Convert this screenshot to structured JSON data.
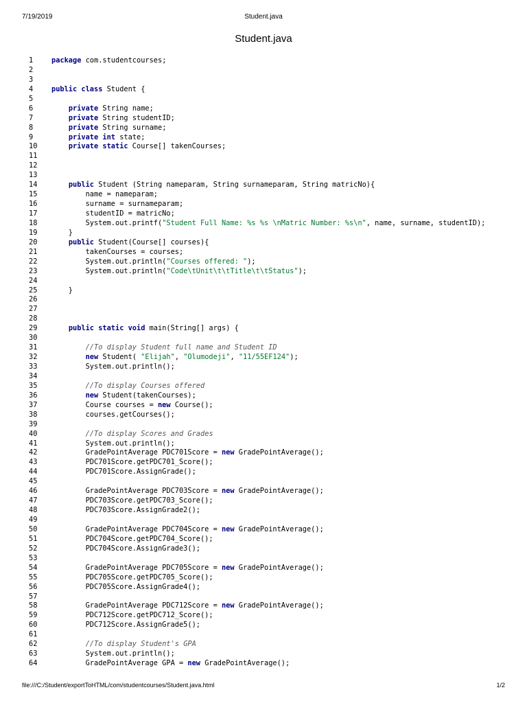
{
  "header": {
    "date": "7/19/2019",
    "file_title": "Student.java"
  },
  "document_title": "Student.java",
  "code_lines": [
    [
      [
        "kw",
        "package"
      ],
      [
        "p",
        " com.studentcourses;"
      ]
    ],
    [],
    [],
    [
      [
        "kw",
        "public class"
      ],
      [
        "p",
        " Student {"
      ]
    ],
    [],
    [
      [
        "p",
        "    "
      ],
      [
        "kw",
        "private"
      ],
      [
        "p",
        " String name;"
      ]
    ],
    [
      [
        "p",
        "    "
      ],
      [
        "kw",
        "private"
      ],
      [
        "p",
        " String studentID;"
      ]
    ],
    [
      [
        "p",
        "    "
      ],
      [
        "kw",
        "private"
      ],
      [
        "p",
        " String surname;"
      ]
    ],
    [
      [
        "p",
        "    "
      ],
      [
        "kw",
        "private int"
      ],
      [
        "p",
        " state;"
      ]
    ],
    [
      [
        "p",
        "    "
      ],
      [
        "kw",
        "private static"
      ],
      [
        "p",
        " Course[] takenCourses;"
      ]
    ],
    [],
    [],
    [],
    [
      [
        "p",
        "    "
      ],
      [
        "kw",
        "public"
      ],
      [
        "p",
        " Student (String nameparam, String surnameparam, String matricNo){"
      ]
    ],
    [
      [
        "p",
        "        name = nameparam;"
      ]
    ],
    [
      [
        "p",
        "        surname = surnameparam;"
      ]
    ],
    [
      [
        "p",
        "        studentID = matricNo;"
      ]
    ],
    [
      [
        "p",
        "        System.out.printf("
      ],
      [
        "str",
        "\"Student Full Name: %s %s \\nMatric Number: %s\\n\""
      ],
      [
        "p",
        ", name, surname, studentID);"
      ]
    ],
    [
      [
        "p",
        "    }"
      ]
    ],
    [
      [
        "p",
        "    "
      ],
      [
        "kw",
        "public"
      ],
      [
        "p",
        " Student(Course[] courses){"
      ]
    ],
    [
      [
        "p",
        "        takenCourses = courses;"
      ]
    ],
    [
      [
        "p",
        "        System.out.println("
      ],
      [
        "str",
        "\"Courses offered: \""
      ],
      [
        "p",
        ");"
      ]
    ],
    [
      [
        "p",
        "        System.out.println("
      ],
      [
        "str",
        "\"Code\\tUnit\\t\\tTitle\\t\\tStatus\""
      ],
      [
        "p",
        ");"
      ]
    ],
    [],
    [
      [
        "p",
        "    }"
      ]
    ],
    [],
    [],
    [],
    [
      [
        "p",
        "    "
      ],
      [
        "kw",
        "public static void"
      ],
      [
        "p",
        " main(String[] args) {"
      ]
    ],
    [],
    [
      [
        "p",
        "        "
      ],
      [
        "cmt",
        "//To display Student full name and Student ID"
      ]
    ],
    [
      [
        "p",
        "        "
      ],
      [
        "kw",
        "new"
      ],
      [
        "p",
        " Student( "
      ],
      [
        "str",
        "\"Elijah\""
      ],
      [
        "p",
        ", "
      ],
      [
        "str",
        "\"Olumodeji\""
      ],
      [
        "p",
        ", "
      ],
      [
        "str",
        "\"11/55EF124\""
      ],
      [
        "p",
        ");"
      ]
    ],
    [
      [
        "p",
        "        System.out.println();"
      ]
    ],
    [],
    [
      [
        "p",
        "        "
      ],
      [
        "cmt",
        "//To display Courses offered"
      ]
    ],
    [
      [
        "p",
        "        "
      ],
      [
        "kw",
        "new"
      ],
      [
        "p",
        " Student(takenCourses);"
      ]
    ],
    [
      [
        "p",
        "        Course courses = "
      ],
      [
        "kw",
        "new"
      ],
      [
        "p",
        " Course();"
      ]
    ],
    [
      [
        "p",
        "        courses.getCourses();"
      ]
    ],
    [],
    [
      [
        "p",
        "        "
      ],
      [
        "cmt",
        "//To display Scores and Grades"
      ]
    ],
    [
      [
        "p",
        "        System.out.println();"
      ]
    ],
    [
      [
        "p",
        "        GradePointAverage PDC701Score = "
      ],
      [
        "kw",
        "new"
      ],
      [
        "p",
        " GradePointAverage();"
      ]
    ],
    [
      [
        "p",
        "        PDC701Score.getPDC701_Score();"
      ]
    ],
    [
      [
        "p",
        "        PDC701Score.AssignGrade();"
      ]
    ],
    [],
    [
      [
        "p",
        "        GradePointAverage PDC703Score = "
      ],
      [
        "kw",
        "new"
      ],
      [
        "p",
        " GradePointAverage();"
      ]
    ],
    [
      [
        "p",
        "        PDC703Score.getPDC703_Score();"
      ]
    ],
    [
      [
        "p",
        "        PDC703Score.AssignGrade2();"
      ]
    ],
    [],
    [
      [
        "p",
        "        GradePointAverage PDC704Score = "
      ],
      [
        "kw",
        "new"
      ],
      [
        "p",
        " GradePointAverage();"
      ]
    ],
    [
      [
        "p",
        "        PDC704Score.getPDC704_Score();"
      ]
    ],
    [
      [
        "p",
        "        PDC704Score.AssignGrade3();"
      ]
    ],
    [],
    [
      [
        "p",
        "        GradePointAverage PDC705Score = "
      ],
      [
        "kw",
        "new"
      ],
      [
        "p",
        " GradePointAverage();"
      ]
    ],
    [
      [
        "p",
        "        PDC705Score.getPDC705_Score();"
      ]
    ],
    [
      [
        "p",
        "        PDC705Score.AssignGrade4();"
      ]
    ],
    [],
    [
      [
        "p",
        "        GradePointAverage PDC712Score = "
      ],
      [
        "kw",
        "new"
      ],
      [
        "p",
        " GradePointAverage();"
      ]
    ],
    [
      [
        "p",
        "        PDC712Score.getPDC712_Score();"
      ]
    ],
    [
      [
        "p",
        "        PDC712Score.AssignGrade5();"
      ]
    ],
    [],
    [
      [
        "p",
        "        "
      ],
      [
        "cmt",
        "//To display Student's GPA"
      ]
    ],
    [
      [
        "p",
        "        System.out.println();"
      ]
    ],
    [
      [
        "p",
        "        GradePointAverage GPA = "
      ],
      [
        "kw",
        "new"
      ],
      [
        "p",
        " GradePointAverage();"
      ]
    ]
  ],
  "footer": {
    "path": "file:///C:/Student/exportToHTML/com/studentcourses/Student.java.html",
    "page": "1/2"
  },
  "colors": {
    "keyword": "#000080",
    "string": "#00782d",
    "comment": "#555555"
  }
}
